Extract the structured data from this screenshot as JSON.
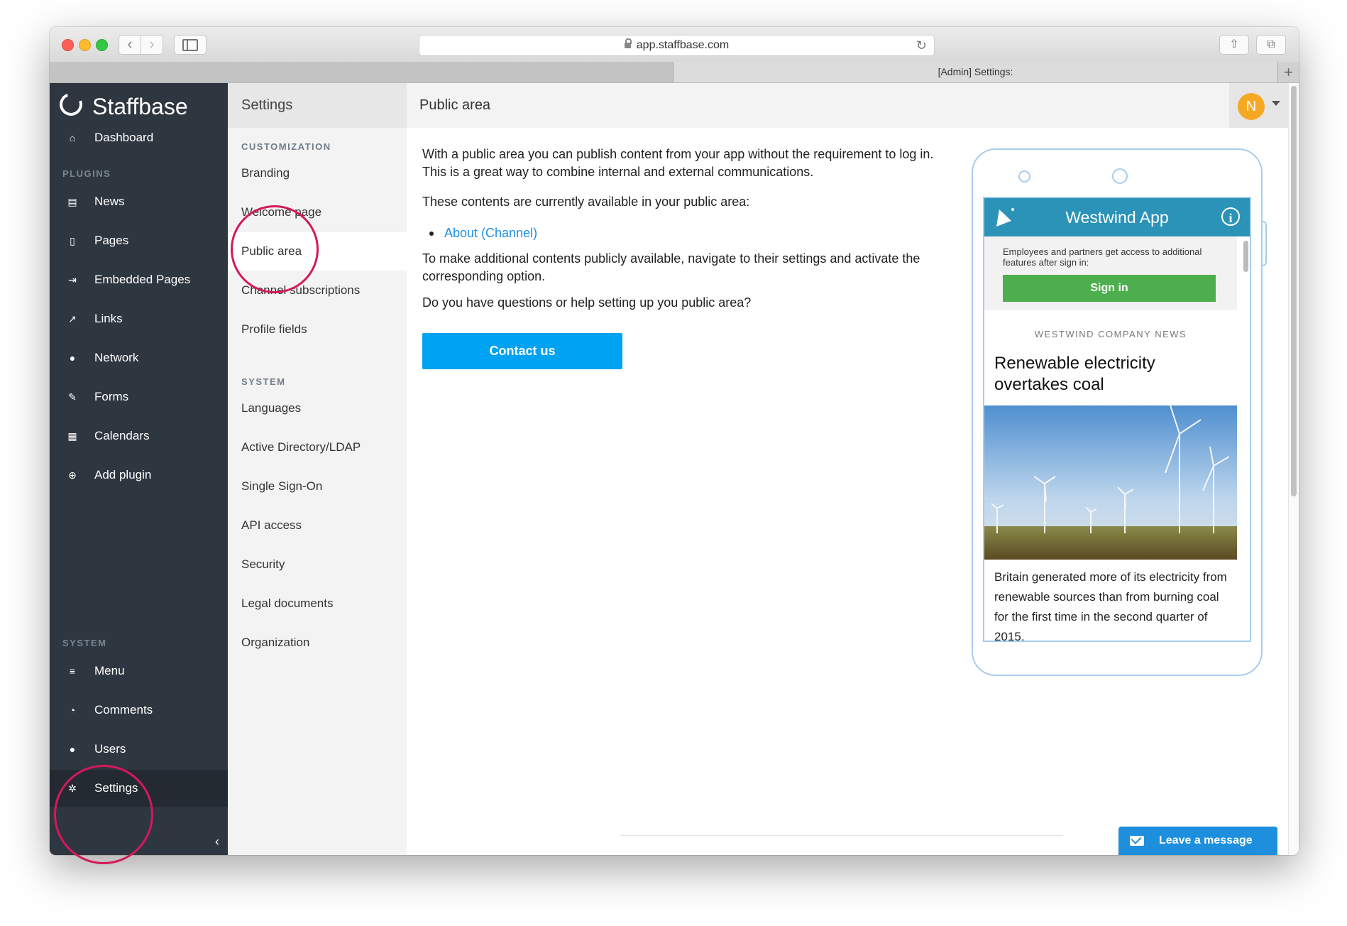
{
  "browser": {
    "url": "app.staffbase.com",
    "tab_title": "[Admin] Settings:",
    "new_tab": "+"
  },
  "leftnav": {
    "brand": "Staffbase",
    "top_items": [
      {
        "label": "Dashboard",
        "icon": "home-icon"
      }
    ],
    "plugins_header": "PLUGINS",
    "plugin_items": [
      {
        "label": "News",
        "icon": "newspaper-icon"
      },
      {
        "label": "Pages",
        "icon": "page-icon"
      },
      {
        "label": "Embedded Pages",
        "icon": "embed-icon"
      },
      {
        "label": "Links",
        "icon": "external-link-icon"
      },
      {
        "label": "Network",
        "icon": "users-icon"
      },
      {
        "label": "Forms",
        "icon": "edit-icon"
      },
      {
        "label": "Calendars",
        "icon": "calendar-icon"
      },
      {
        "label": "Add plugin",
        "icon": "plus-circle-icon"
      }
    ],
    "system_header": "SYSTEM",
    "system_items": [
      {
        "label": "Menu",
        "icon": "menu-icon"
      },
      {
        "label": "Comments",
        "icon": "comments-icon"
      },
      {
        "label": "Users",
        "icon": "users-icon"
      },
      {
        "label": "Settings",
        "icon": "gear-icon"
      }
    ],
    "collapse": "‹"
  },
  "settings": {
    "title": "Settings",
    "customization_header": "CUSTOMIZATION",
    "customization_items": [
      "Branding",
      "Welcome page",
      "Public area",
      "Channel subscriptions",
      "Profile fields"
    ],
    "system_header": "SYSTEM",
    "system_items": [
      "Languages",
      "Active Directory/LDAP",
      "Single Sign-On",
      "API access",
      "Security",
      "Legal documents",
      "Organization"
    ]
  },
  "main": {
    "title": "Public area",
    "avatar_initial": "N",
    "intro_line1": "With a public area you can publish content from your app without the requirement to log in.",
    "intro_line2": "This is a great way to combine internal and external communications.",
    "available_text": "These contents are currently available in your public area:",
    "available_link": "About (Channel)",
    "additional_text": "To make additional contents publicly available, navigate to their settings and activate the corresponding option.",
    "question_text": "Do you have questions or help setting up you public area?",
    "contact_button": "Contact us"
  },
  "phone": {
    "app_title": "Westwind App",
    "info_icon_glyph": "i",
    "signin_text": "Employees and partners get access to additional features after sign in:",
    "signin_button": "Sign in",
    "news_kicker": "WESTWIND COMPANY NEWS",
    "news_title": "Renewable electricity overtakes coal",
    "news_body": "Britain generated more of its electricity from renewable sources than from burning coal for the first time in the second quarter of 2015,"
  },
  "chat": {
    "label": "Leave a message"
  },
  "colors": {
    "nav_bg": "#2e3640",
    "accent_blue": "#00a2f2",
    "link_blue": "#1f8fe6",
    "phone_header": "#2b93b7",
    "signin_green": "#4cae4c",
    "avatar_orange": "#f7a823",
    "annotation_pink": "#d6185c"
  }
}
